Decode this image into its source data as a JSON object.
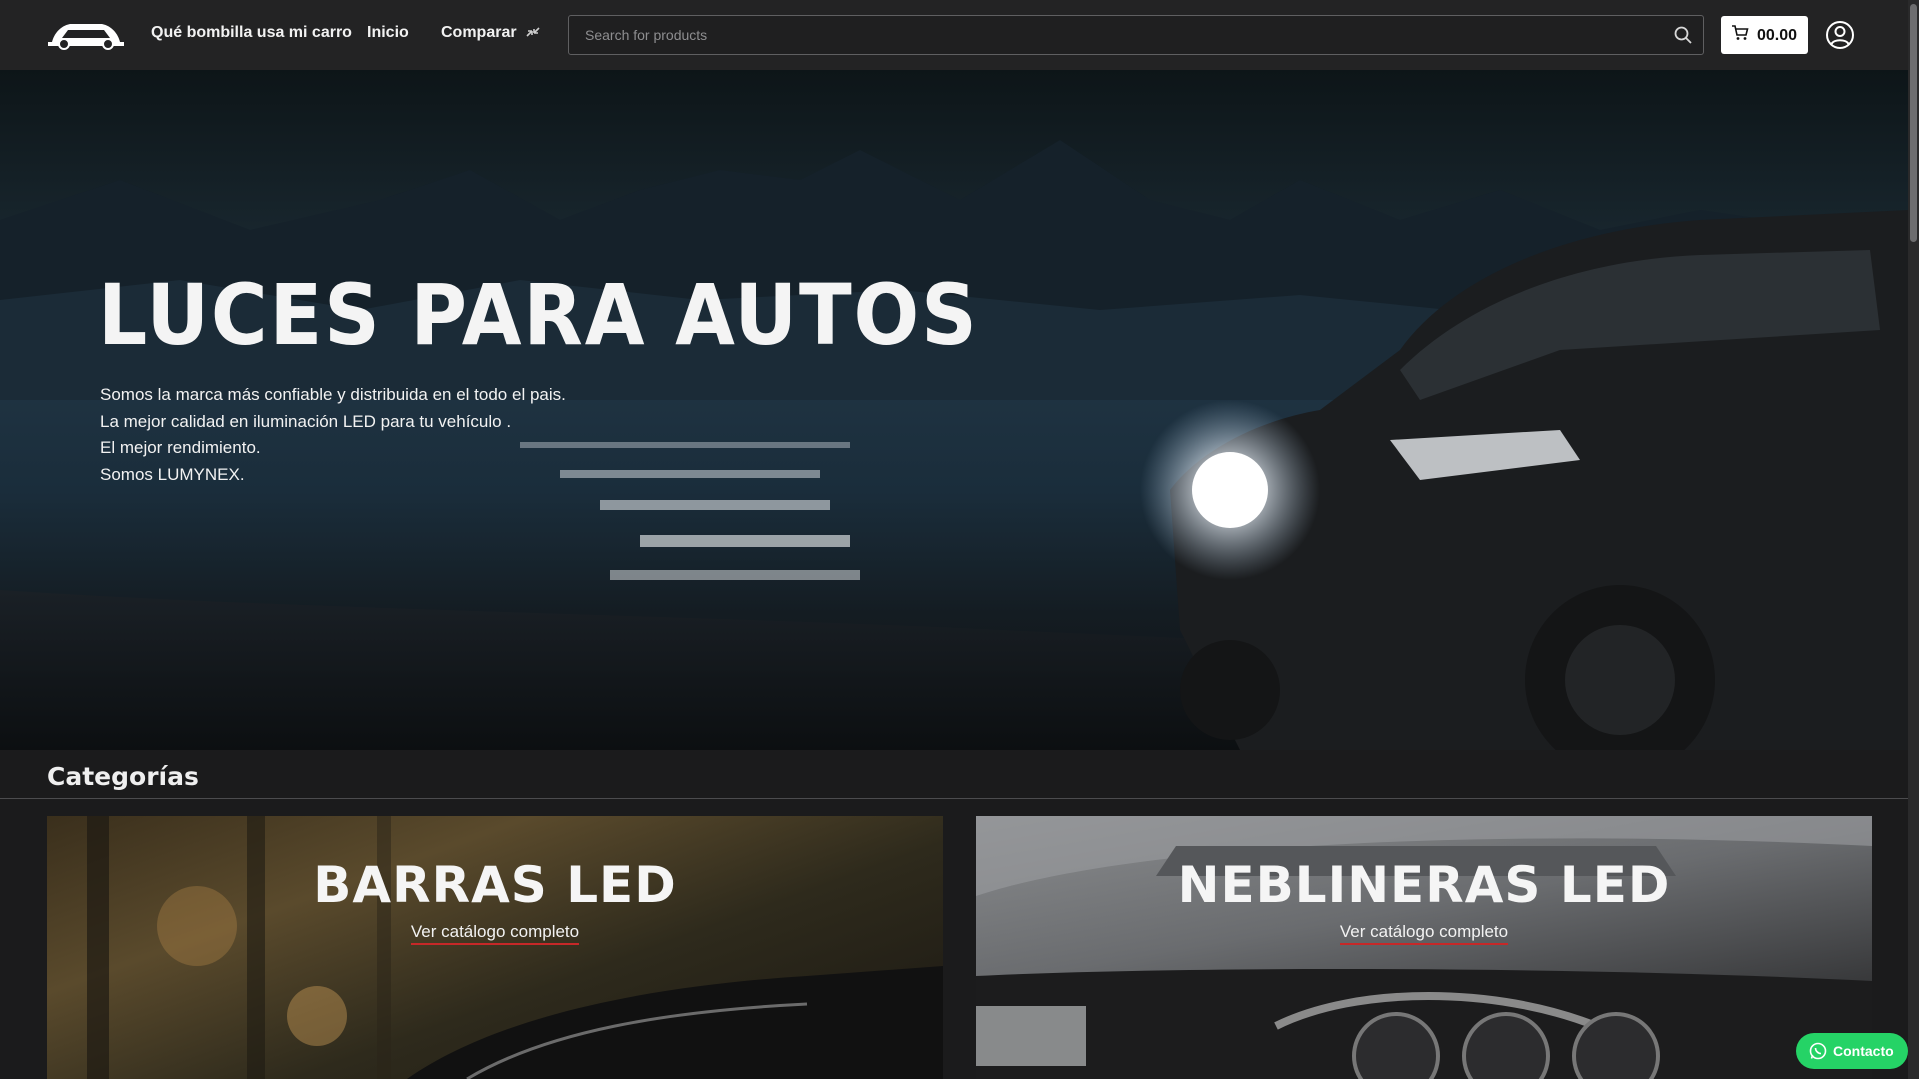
{
  "header": {
    "nav": {
      "bulb_finder": "Qué bombilla usa mi carro",
      "home": "Inicio",
      "compare": "Comparar"
    },
    "search": {
      "placeholder": "Search for products"
    },
    "cart": {
      "total": "00.00"
    }
  },
  "hero": {
    "title": "LUCES PARA AUTOS",
    "lines": [
      "Somos la marca más confiable y distribuida en el todo el pais.",
      "La mejor calidad en iluminación LED para tu vehículo .",
      "El mejor rendimiento.",
      "Somos LUMYNEX."
    ]
  },
  "categories": {
    "heading": "Categorías",
    "items": [
      {
        "title": "BARRAS LED",
        "link": "Ver catálogo completo"
      },
      {
        "title": "NEBLINERAS LED",
        "link": "Ver catálogo completo"
      }
    ]
  },
  "contact": {
    "label": "Contacto"
  },
  "colors": {
    "header_bg": "#232324",
    "page_bg": "#1b1b1c",
    "link_underline": "#c62828",
    "whatsapp_green": "#25d366"
  },
  "icons": [
    "car-logo-icon",
    "compare-icon",
    "search-icon",
    "cart-icon",
    "user-account-icon",
    "whatsapp-icon"
  ]
}
